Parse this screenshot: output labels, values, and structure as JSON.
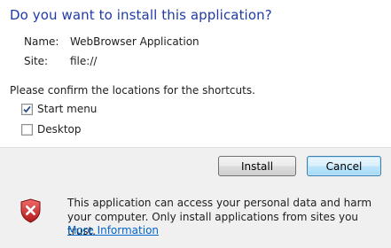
{
  "dialog": {
    "title": "Do you want to install this application?",
    "name_label": "Name:",
    "name_value": "WebBrowser Application",
    "site_label": "Site:",
    "site_value": "file://",
    "confirm_text": "Please confirm the locations for the shortcuts.",
    "shortcuts": [
      {
        "label": "Start menu",
        "checked": true
      },
      {
        "label": "Desktop",
        "checked": false
      }
    ],
    "install_label": "Install",
    "cancel_label": "Cancel",
    "warning_text": "This application can access your personal data and harm your computer. Only install applications from sites you trust.",
    "more_info_link": "More Information",
    "warning_icon": "shield-error-icon",
    "colors": {
      "title": "#1f3ba8",
      "link": "#0066cc",
      "footer_bg": "#f0f0f0",
      "shield_red": "#c62828"
    }
  }
}
